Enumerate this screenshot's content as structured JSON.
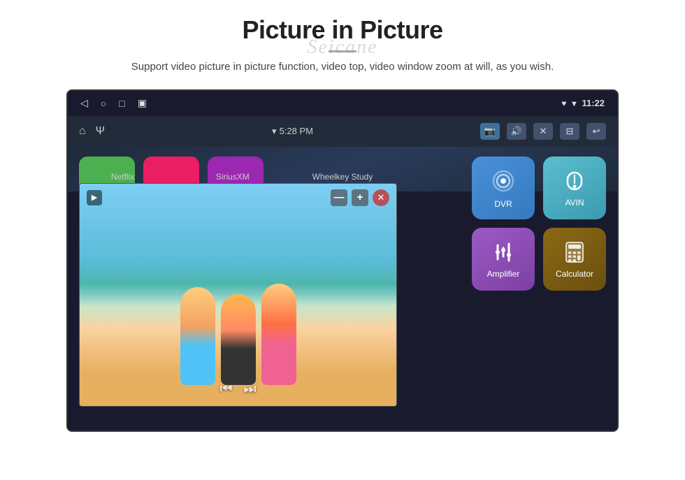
{
  "page": {
    "title": "Picture in Picture",
    "subtitle": "Support video picture in picture function, video top, video window zoom at will, as you wish.",
    "watermark": "Seicane"
  },
  "statusBar": {
    "leftIcons": [
      "◁",
      "○",
      "□",
      "▣"
    ],
    "rightIcons": [
      "♥",
      "▾"
    ],
    "time": "11:22"
  },
  "toolbar": {
    "leftIcons": [
      "⌂",
      "Ψ"
    ],
    "timeDisplay": "5:28 PM",
    "rightButtons": [
      "📷",
      "🔊",
      "✕",
      "⊟",
      "↩"
    ]
  },
  "pip": {
    "minusLabel": "—",
    "plusLabel": "+",
    "closeLabel": "✕",
    "prevLabel": "⏮",
    "playLabel": "▶",
    "nextLabel": "⏭"
  },
  "apps": {
    "row1": [
      {
        "id": "netflix",
        "label": "Netflix",
        "color": "#4caf50"
      },
      {
        "id": "siriusxm",
        "label": "SiriusXM",
        "color": "#e91e63"
      },
      {
        "id": "wheelkey",
        "label": "Wheelkey Study",
        "color": "#9c27b0"
      }
    ],
    "grid": [
      {
        "id": "dvr",
        "label": "DVR",
        "colorClass": "app-dvr"
      },
      {
        "id": "avin",
        "label": "AVIN",
        "colorClass": "app-avin"
      },
      {
        "id": "amplifier",
        "label": "Amplifier",
        "colorClass": "app-amplifier"
      },
      {
        "id": "calculator",
        "label": "Calculator",
        "colorClass": "app-calculator"
      }
    ]
  }
}
